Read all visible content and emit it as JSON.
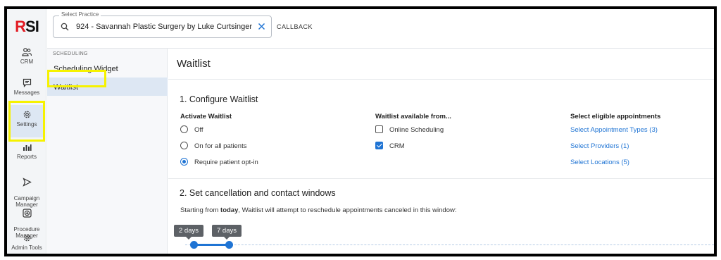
{
  "logo": {
    "text_r": "R",
    "text_si": "SI"
  },
  "rail": [
    {
      "label": "CRM",
      "icon": "people-icon"
    },
    {
      "label": "Messages",
      "icon": "message-icon"
    },
    {
      "label": "Settings",
      "icon": "gear-icon"
    },
    {
      "label": "Reports",
      "icon": "bar-chart-icon"
    },
    {
      "label": "Campaign\nManager",
      "icon": "send-icon"
    },
    {
      "label": "Procedure\nManager",
      "icon": "plus-box-icon"
    },
    {
      "label": "Admin Tools",
      "icon": "gear-icon"
    }
  ],
  "topbar": {
    "practice_legend": "Select Practice",
    "practice_value": "924 - Savannah Plastic Surgery by Luke Curtsinger",
    "callback": "CALLBACK"
  },
  "subnav": {
    "header": "SCHEDULING",
    "items": [
      "Scheduling Widget",
      "Waitlist"
    ]
  },
  "main": {
    "title": "Waitlist",
    "section1": {
      "title": "1. Configure Waitlist",
      "activate_header": "Activate Waitlist",
      "activate_options": [
        "Off",
        "On for all patients",
        "Require patient opt-in"
      ],
      "activate_selected": "Require patient opt-in",
      "available_header": "Waitlist available from...",
      "available_options": [
        {
          "label": "Online Scheduling",
          "checked": false
        },
        {
          "label": "CRM",
          "checked": true
        }
      ],
      "eligible_header": "Select eligible appointments",
      "eligible_links": [
        "Select Appointment Types (3)",
        "Select Providers (1)",
        "Select Locations (5)"
      ]
    },
    "section2": {
      "title": "2. Set cancellation and contact windows",
      "desc_prefix": "Starting from ",
      "desc_bold": "today",
      "desc_suffix": ", Waitlist will attempt to reschedule appointments canceled in this window:",
      "slider_min_label": "2 days",
      "slider_max_label": "7 days"
    }
  },
  "colors": {
    "accent": "#1f74d4",
    "highlight": "#f6f200",
    "brand_red": "#e21b23"
  }
}
